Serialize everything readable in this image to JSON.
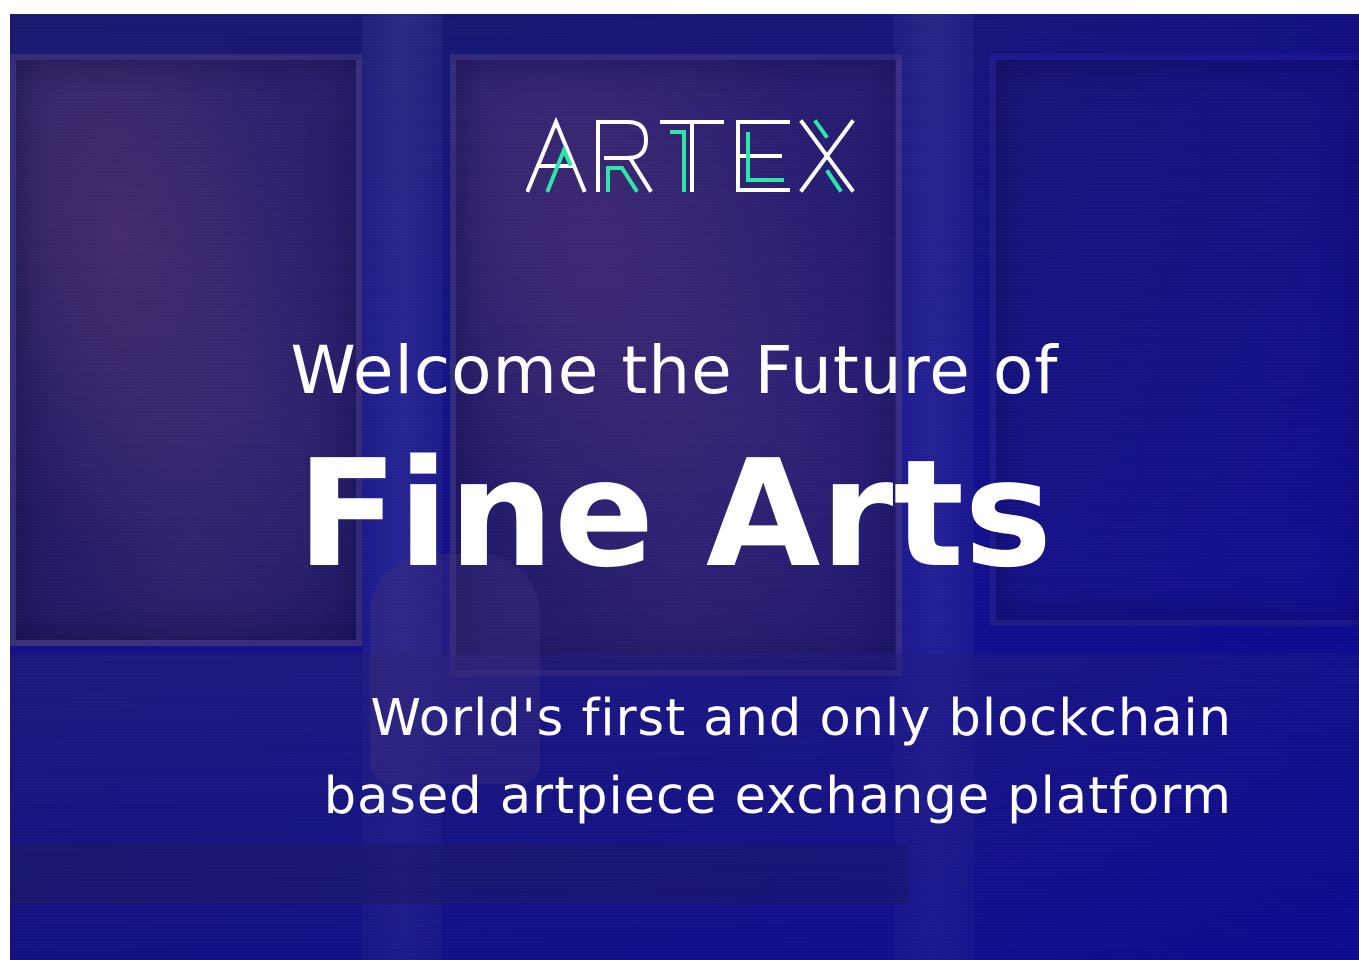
{
  "brand": {
    "name": "ARTEX",
    "accent_color": "#2ee6a8",
    "text_color": "#ffffff"
  },
  "hero": {
    "welcome": "Welcome the Future of",
    "headline": "Fine Arts",
    "subtitle_line1": "World's first and only blockchain",
    "subtitle_line2": "based artpiece exchange platform"
  },
  "colors": {
    "background": "#13118a",
    "text": "#ffffff"
  }
}
